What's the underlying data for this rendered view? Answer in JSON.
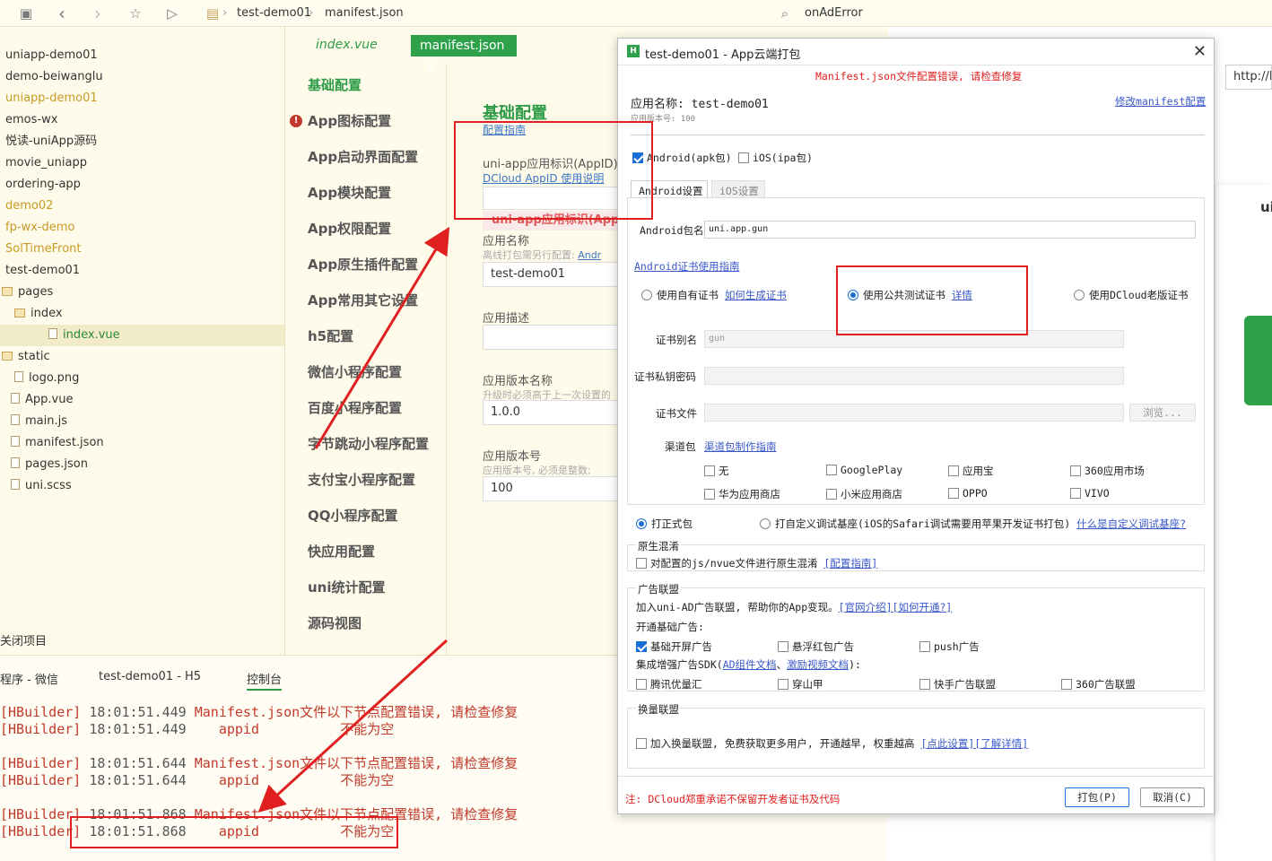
{
  "topbar": {
    "breadcrumb_project": "test-demo01",
    "breadcrumb_file": "manifest.json",
    "search_text": "onAdError"
  },
  "tree": {
    "items": [
      {
        "label": "uniapp-demo01",
        "style": "normal"
      },
      {
        "label": "demo-beiwanglu",
        "style": "normal"
      },
      {
        "label": "uniapp-demo01",
        "style": "gold"
      },
      {
        "label": "emos-wx",
        "style": "normal"
      },
      {
        "label": "悦读-uniApp源码",
        "style": "normal"
      },
      {
        "label": "movie_uniapp",
        "style": "normal"
      },
      {
        "label": "ordering-app",
        "style": "normal"
      },
      {
        "label": "demo02",
        "style": "gold"
      },
      {
        "label": "fp-wx-demo",
        "style": "gold"
      },
      {
        "label": "SolTimeFront",
        "style": "gold"
      },
      {
        "label": "test-demo01",
        "style": "normal"
      },
      {
        "label": "pages",
        "style": "normal"
      },
      {
        "label": "index",
        "style": "normal"
      },
      {
        "label": "index.vue",
        "style": "selected"
      },
      {
        "label": "static",
        "style": "normal"
      },
      {
        "label": "logo.png",
        "style": "normal"
      },
      {
        "label": "App.vue",
        "style": "normal"
      },
      {
        "label": "main.js",
        "style": "normal"
      },
      {
        "label": "manifest.json",
        "style": "normal"
      },
      {
        "label": "pages.json",
        "style": "normal"
      },
      {
        "label": "uni.scss",
        "style": "normal"
      }
    ],
    "close_project": "关闭项目"
  },
  "editor": {
    "tab_index": "index.vue",
    "tab_manifest": "manifest.json",
    "nav": [
      "基础配置",
      "App图标配置",
      "App启动界面配置",
      "App模块配置",
      "App权限配置",
      "App原生插件配置",
      "App常用其它设置",
      "h5配置",
      "微信小程序配置",
      "百度小程序配置",
      "字节跳动小程序配置",
      "支付宝小程序配置",
      "QQ小程序配置",
      "快应用配置",
      "uni统计配置",
      "源码视图"
    ],
    "form": {
      "heading": "基础配置",
      "guide_link": "配置指南",
      "appid_label": "uni-app应用标识(AppID)",
      "appid_link": "DCloud AppID 使用说明",
      "appid_error": "uni-app应用标识(AppID)",
      "name_label": "应用名称",
      "name_sub": "离线打包需另行配置: ",
      "name_sub_link": "Andr",
      "name_value": "test-demo01",
      "desc_label": "应用描述",
      "vname_label": "应用版本名称",
      "vname_sub": "升级时必须高于上一次设置的",
      "vname_value": "1.0.0",
      "vcode_label": "应用版本号",
      "vcode_sub": "应用版本号, 必须是整数; ",
      "vcode_value": "100"
    }
  },
  "console": {
    "tabs": [
      "程序 - 微信",
      "test-demo01 - H5",
      "控制台"
    ],
    "lines": [
      {
        "prefix": "[HBuilder]",
        "time": "18:01:51.449",
        "msg": "Manifest.json文件以下节点配置错误, 请检查修复"
      },
      {
        "prefix": "[HBuilder]",
        "time": "18:01:51.449",
        "msg": "   appid          不能为空"
      },
      {
        "prefix": "[HBuilder]",
        "time": "18:01:51.644",
        "msg": "Manifest.json文件以下节点配置错误, 请检查修复"
      },
      {
        "prefix": "[HBuilder]",
        "time": "18:01:51.644",
        "msg": "   appid          不能为空"
      },
      {
        "prefix": "[HBuilder]",
        "time": "18:01:51.868",
        "msg": "Manifest.json文件以下节点配置错误, 请检查修复"
      },
      {
        "prefix": "[HBuilder]",
        "time": "18:01:51.868",
        "msg": "   appid          不能为空"
      }
    ]
  },
  "right": {
    "url": "http://lc",
    "text_un": "ui"
  },
  "dialog": {
    "title": "test-demo01 - App云端打包",
    "error": "Manifest.json文件配置错误, 请检查修复",
    "app_name": "应用名称: test-demo01",
    "modify_link": "修改manifest配置",
    "version": "应用版本号: 100",
    "android_cb": "Android(apk包)",
    "ios_cb": "iOS(ipa包)",
    "tab_android": "Android设置",
    "tab_ios": "iOS设置",
    "pkg_label": "Android包名",
    "pkg_value": "uni.app.gun",
    "cert_guide": "Android证书使用指南",
    "cert_own": "使用自有证书",
    "cert_own_link": "如何生成证书",
    "cert_public": "使用公共测试证书",
    "cert_public_link": "详情",
    "cert_old": "使用DCloud老版证书",
    "alias_label": "证书别名",
    "alias_value": "gun",
    "pwd_label": "证书私钥密码",
    "file_label": "证书文件",
    "browse": "浏览...",
    "channel_label": "渠道包",
    "channel_link": "渠道包制作指南",
    "channels": [
      "无",
      "GooglePlay",
      "应用宝",
      "360应用市场",
      "华为应用商店",
      "小米应用商店",
      "OPPO",
      "VIVO"
    ],
    "formal": "打正式包",
    "custom": "打自定义调试基座(iOS的Safari调试需要用苹果开发证书打包)",
    "custom_link": "什么是自定义调试基座?",
    "obf_title": "原生混淆",
    "obf_cb": "对配置的js/nvue文件进行原生混淆",
    "obf_link": "[配置指南]",
    "ad_title": "广告联盟",
    "ad_desc": "加入uni-AD广告联盟, 帮助你的App变现。",
    "ad_link1": "[官网介绍]",
    "ad_link2": "[如何开通?]",
    "ad_basic": "开通基础广告:",
    "ad_splash": "基础开屏广告",
    "ad_float": "悬浮红包广告",
    "ad_push": "push广告",
    "ad_sdk": "集成增强广告SDK(",
    "ad_sdk_link1": "AD组件文档",
    "ad_sdk_sep": "、",
    "ad_sdk_link2": "激励视频文档",
    "ad_sdk_end": "):",
    "ad_tencent": "腾讯优量汇",
    "ad_csj": "穿山甲",
    "ad_ks": "快手广告联盟",
    "ad_360": "360广告联盟",
    "swap_title": "换量联盟",
    "swap_cb": "加入换量联盟, 免费获取更多用户, 开通越早, 权重越高",
    "swap_link1": "[点此设置]",
    "swap_link2": "[了解详情]",
    "footer_note": "注: DCloud郑重承诺不保留开发者证书及代码",
    "pack_btn": "打包(P)",
    "cancel_btn": "取消(C)"
  },
  "colors": {
    "accent": "#2fa14b",
    "error": "#e02020",
    "link": "#3a58c8"
  }
}
